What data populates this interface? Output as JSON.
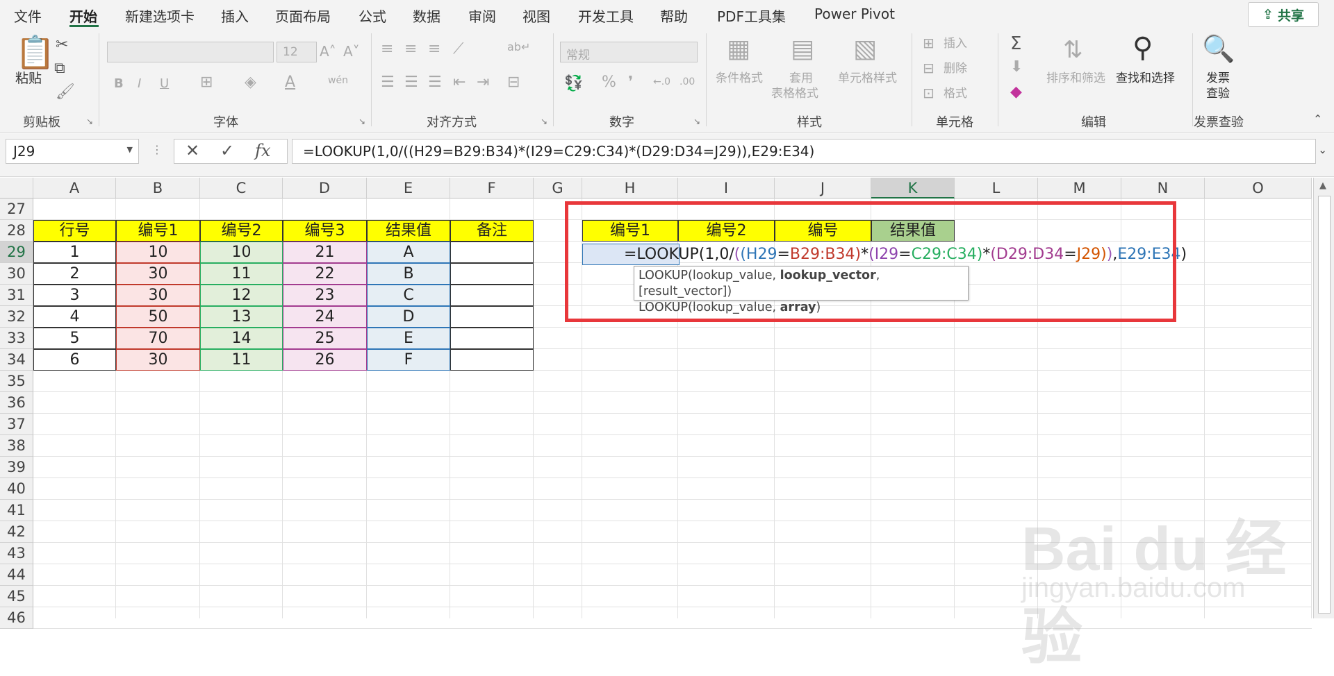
{
  "tabs": [
    "文件",
    "开始",
    "新建选项卡",
    "插入",
    "页面布局",
    "公式",
    "数据",
    "审阅",
    "视图",
    "开发工具",
    "帮助",
    "PDF工具集",
    "Power Pivot"
  ],
  "share_label": "共享",
  "ribbon": {
    "clipboard": {
      "paste": "粘贴",
      "group": "剪贴板"
    },
    "font": {
      "group": "字体",
      "size": "12"
    },
    "alignment": {
      "group": "对齐方式"
    },
    "number": {
      "group": "数字",
      "format": "常规"
    },
    "styles": {
      "group": "样式",
      "cond": "条件格式",
      "table1": "套用",
      "table2": "表格格式",
      "cell": "单元格样式"
    },
    "cells": {
      "group": "单元格",
      "insert": "插入",
      "delete": "删除",
      "format": "格式"
    },
    "editing": {
      "group": "编辑",
      "sort": "排序和筛选",
      "find": "查找和选择"
    },
    "invoice": {
      "group": "发票查验",
      "btn1": "发票",
      "btn2": "查验"
    }
  },
  "name_box": "J29",
  "formula_bar": "=LOOKUP(1,0/((H29=B29:B34)*(I29=C29:C34)*(D29:D34=J29)),E29:E34)",
  "columns": [
    "A",
    "B",
    "C",
    "D",
    "E",
    "F",
    "G",
    "H",
    "I",
    "J",
    "K",
    "L",
    "M",
    "N",
    "O"
  ],
  "rows": [
    "27",
    "28",
    "29",
    "30",
    "31",
    "32",
    "33",
    "34",
    "35",
    "36",
    "37",
    "38",
    "39",
    "40",
    "41",
    "42",
    "43",
    "44",
    "45",
    "46"
  ],
  "table": {
    "headers": [
      "行号",
      "编号1",
      "编号2",
      "编号3",
      "结果值",
      "备注"
    ],
    "rows": [
      [
        "1",
        "10",
        "10",
        "21",
        "A",
        ""
      ],
      [
        "2",
        "30",
        "11",
        "22",
        "B",
        ""
      ],
      [
        "3",
        "30",
        "12",
        "23",
        "C",
        ""
      ],
      [
        "4",
        "50",
        "13",
        "24",
        "D",
        ""
      ],
      [
        "5",
        "70",
        "14",
        "25",
        "E",
        ""
      ],
      [
        "6",
        "30",
        "11",
        "26",
        "F",
        ""
      ]
    ]
  },
  "lookup_headers": [
    "编号1",
    "编号2",
    "编号",
    "结果值"
  ],
  "edit_formula": [
    {
      "t": "=LOOKUP(1,0/",
      "c": "#222222"
    },
    {
      "t": "(",
      "c": "#9b59b6"
    },
    {
      "t": "(",
      "c": "#2e75b6"
    },
    {
      "t": "H29",
      "c": "#2e75b6"
    },
    {
      "t": "=",
      "c": "#222222"
    },
    {
      "t": "B29:B34",
      "c": "#c0392b"
    },
    {
      "t": ")",
      "c": "#c0392b"
    },
    {
      "t": "*",
      "c": "#222222"
    },
    {
      "t": "(",
      "c": "#8e44ad"
    },
    {
      "t": "I29",
      "c": "#8e44ad"
    },
    {
      "t": "=",
      "c": "#222222"
    },
    {
      "t": "C29:C34",
      "c": "#27ae60"
    },
    {
      "t": ")",
      "c": "#27ae60"
    },
    {
      "t": "*",
      "c": "#222222"
    },
    {
      "t": "(",
      "c": "#a23b8f"
    },
    {
      "t": "D29:D34",
      "c": "#a23b8f"
    },
    {
      "t": "=",
      "c": "#222222"
    },
    {
      "t": "J29",
      "c": "#d35400"
    },
    {
      "t": ")",
      "c": "#d35400"
    },
    {
      "t": ")",
      "c": "#9b59b6"
    },
    {
      "t": ",",
      "c": "#222222"
    },
    {
      "t": "E29:E34",
      "c": "#2e75b6"
    },
    {
      "t": ")",
      "c": "#222222"
    }
  ],
  "tooltip": {
    "line1_a": "LOOKUP(lookup_value, ",
    "line1_b": "lookup_vector",
    "line1_c": ", [result_vector])",
    "line2_a": "LOOKUP(lookup_value, ",
    "line2_b": "array",
    "line2_c": ")"
  },
  "watermark": {
    "big": "Bai du 经验",
    "small": "jingyan.baidu.com"
  },
  "colors": {
    "accent": "#217346",
    "red_box": "#e8373b",
    "yellow": "#ffff00",
    "green_header": "#a9d08e"
  }
}
